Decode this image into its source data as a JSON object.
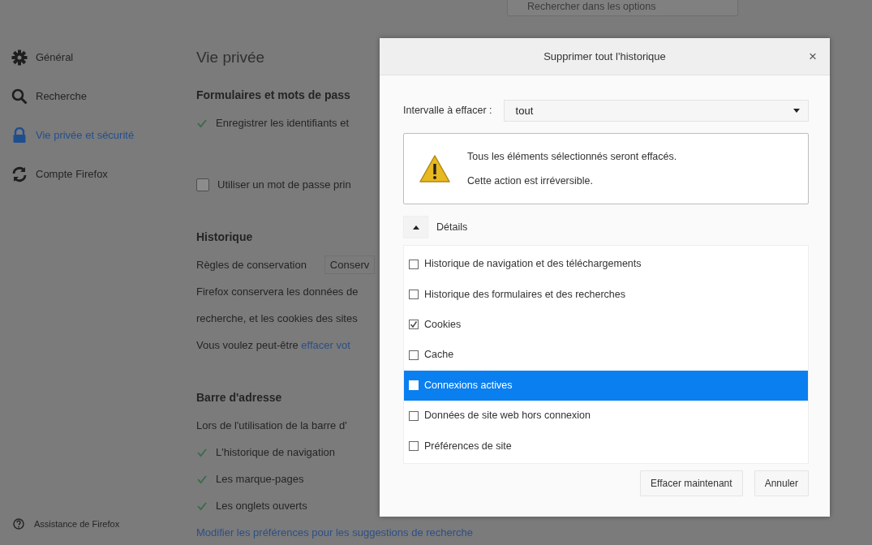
{
  "search": {
    "placeholder": "Rechercher dans les options"
  },
  "sidebar": {
    "items": [
      {
        "label": "Général",
        "selected": false
      },
      {
        "label": "Recherche",
        "selected": false
      },
      {
        "label": "Vie privée et sécurité",
        "selected": true
      },
      {
        "label": "Compte Firefox",
        "selected": false
      }
    ],
    "footer": {
      "label": "Assistance de Firefox"
    }
  },
  "content": {
    "title": "Vie privée",
    "sections": [
      {
        "heading": "Formulaires et mots de pass",
        "rows": [
          {
            "kind": "check",
            "label": "Enregistrer les identifiants et",
            "checked": true
          },
          {
            "kind": "checkbox",
            "label": "Utiliser un mot de passe prin",
            "checked": false
          }
        ]
      },
      {
        "heading": "Historique",
        "rows": [
          {
            "kind": "select",
            "label": "Règles de conservation",
            "value": "Conserv"
          },
          {
            "kind": "text",
            "text": "Firefox conservera les données de"
          },
          {
            "kind": "text",
            "text": "recherche, et les cookies des sites"
          },
          {
            "kind": "text_link",
            "text": "Vous voulez peut-être",
            "link": "effacer vot"
          }
        ]
      },
      {
        "heading": "Barre d'adresse",
        "rows": [
          {
            "kind": "text",
            "text": "Lors de l'utilisation de la barre d'"
          },
          {
            "kind": "check",
            "label": "L'historique de navigation",
            "checked": true
          },
          {
            "kind": "check",
            "label": "Les marque-pages",
            "checked": true
          },
          {
            "kind": "check",
            "label": "Les onglets ouverts",
            "checked": true
          },
          {
            "kind": "link",
            "link": "Modifier les préférences pour les suggestions de recherche"
          }
        ]
      }
    ]
  },
  "dialog": {
    "title": "Supprimer tout l'historique",
    "close": "×",
    "range": {
      "label": "Intervalle à effacer :",
      "value": "tout"
    },
    "warning": [
      "Tous les éléments sélectionnés seront effacés.",
      "Cette action est irréversible."
    ],
    "details": {
      "label": "Détails",
      "expanded": true
    },
    "items": [
      {
        "label": "Historique de navigation et des téléchargements",
        "checked": false,
        "selected": false
      },
      {
        "label": "Historique des formulaires et des recherches",
        "checked": false,
        "selected": false
      },
      {
        "label": "Cookies",
        "checked": true,
        "selected": false
      },
      {
        "label": "Cache",
        "checked": false,
        "selected": false
      },
      {
        "label": "Connexions actives",
        "checked": false,
        "selected": true
      },
      {
        "label": "Données de site web hors connexion",
        "checked": false,
        "selected": false
      },
      {
        "label": "Préférences de site",
        "checked": false,
        "selected": false
      }
    ],
    "buttons": [
      "Effacer maintenant",
      "Annuler"
    ]
  }
}
